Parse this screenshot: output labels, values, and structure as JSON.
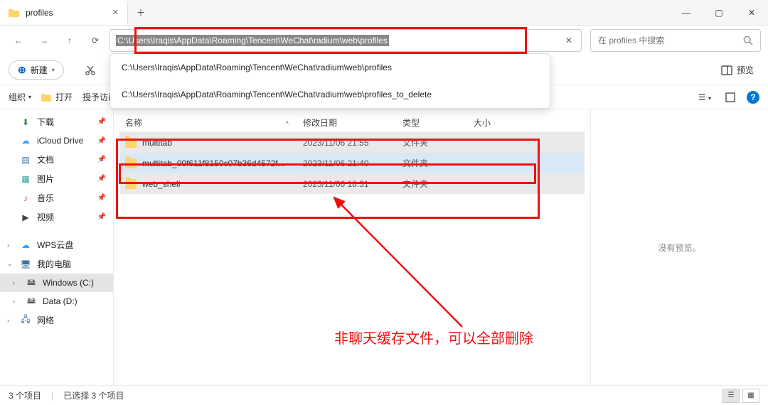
{
  "window": {
    "tab_title": "profiles"
  },
  "address": {
    "path": "C:\\Users\\Iraqis\\AppData\\Roaming\\Tencent\\WeChat\\radium\\web\\profiles",
    "suggestions": [
      "C:\\Users\\Iraqis\\AppData\\Roaming\\Tencent\\WeChat\\radium\\web\\profiles",
      "C:\\Users\\Iraqis\\AppData\\Roaming\\Tencent\\WeChat\\radium\\web\\profiles_to_delete"
    ]
  },
  "search": {
    "placeholder": "在 profiles 中搜索"
  },
  "toolbar": {
    "new_label": "新建",
    "preview_label": "预览"
  },
  "orgbar": {
    "organize": "组织",
    "open": "打开",
    "grant": "授予访问..."
  },
  "sidebar": {
    "quick": [
      {
        "label": "下载",
        "icon": "download-icon"
      },
      {
        "label": "iCloud Drive",
        "icon": "cloud-icon"
      },
      {
        "label": "文档",
        "icon": "document-icon"
      },
      {
        "label": "图片",
        "icon": "pictures-icon"
      },
      {
        "label": "音乐",
        "icon": "music-icon"
      },
      {
        "label": "视频",
        "icon": "video-icon"
      }
    ],
    "groups": [
      {
        "label": "WPS云盘",
        "icon": "wps-icon",
        "expandable": true
      },
      {
        "label": "我的电脑",
        "icon": "pc-icon",
        "expanded": true,
        "children": [
          {
            "label": "Windows (C:)",
            "icon": "drive-icon",
            "selected": true
          },
          {
            "label": "Data (D:)",
            "icon": "drive-icon"
          }
        ]
      },
      {
        "label": "网络",
        "icon": "network-icon",
        "expandable": true
      }
    ]
  },
  "columns": {
    "name": "名称",
    "date": "修改日期",
    "type": "类型",
    "size": "大小"
  },
  "files": [
    {
      "name": "multitab",
      "date": "2023/11/06 21:55",
      "type": "文件夹",
      "size": ""
    },
    {
      "name": "multitab_00f611f8150c07b36d4572f...",
      "date": "2023/11/06 21:40",
      "type": "文件夹",
      "size": ""
    },
    {
      "name": "web_shell",
      "date": "2023/11/06 18:31",
      "type": "文件夹",
      "size": ""
    }
  ],
  "preview": {
    "empty": "没有预览。"
  },
  "status": {
    "total": "3 个项目",
    "selected": "已选择 3 个项目"
  },
  "annotation": {
    "text": "非聊天缓存文件，可以全部删除"
  }
}
